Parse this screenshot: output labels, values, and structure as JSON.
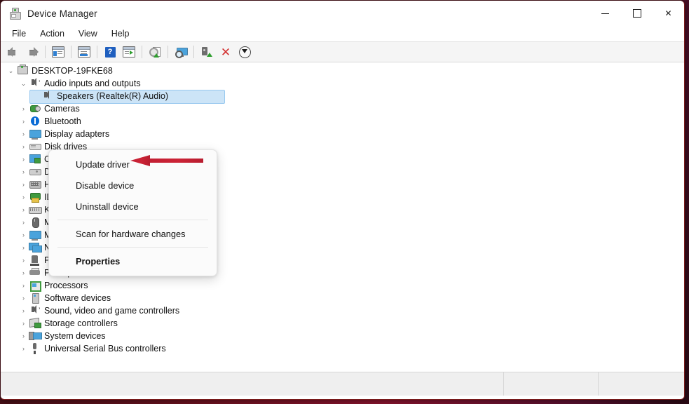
{
  "window": {
    "title": "Device Manager",
    "icon": "device-manager-icon",
    "caption": {
      "minimize": "minimize",
      "maximize": "maximize",
      "close": "close"
    }
  },
  "menubar": {
    "items": [
      "File",
      "Action",
      "View",
      "Help"
    ]
  },
  "toolbar": {
    "buttons": [
      {
        "name": "back-icon",
        "type": "arrow-left"
      },
      {
        "name": "forward-icon",
        "type": "arrow-right"
      },
      {
        "name": "separator-1",
        "type": "sep"
      },
      {
        "name": "show-hide-console-tree-icon",
        "type": "panel-left"
      },
      {
        "name": "separator-2",
        "type": "sep"
      },
      {
        "name": "properties-icon",
        "type": "panel-props"
      },
      {
        "name": "separator-3",
        "type": "sep"
      },
      {
        "name": "help-icon",
        "type": "help"
      },
      {
        "name": "show-action-pane-icon",
        "type": "panel-play"
      },
      {
        "name": "separator-4",
        "type": "sep"
      },
      {
        "name": "update-driver-icon",
        "type": "gear-page"
      },
      {
        "name": "separator-5",
        "type": "sep"
      },
      {
        "name": "scan-for-hardware-changes-icon",
        "type": "monitor-scan"
      },
      {
        "name": "separator-6",
        "type": "sep"
      },
      {
        "name": "enable-device-icon",
        "type": "device-green"
      },
      {
        "name": "uninstall-device-icon",
        "type": "red-x"
      },
      {
        "name": "disable-device-icon",
        "type": "down-circle"
      }
    ]
  },
  "tree": {
    "nodes": [
      {
        "label": "DESKTOP-19FKE68",
        "level": 1,
        "expanded": true,
        "chevron": "⌄",
        "icon": "computer-icon",
        "selected": false
      },
      {
        "label": "Audio inputs and outputs",
        "level": 2,
        "expanded": true,
        "chevron": "⌄",
        "icon": "speaker-icon",
        "selected": false
      },
      {
        "label": "Speakers (Realtek(R) Audio)",
        "level": 3,
        "expanded": false,
        "chevron": "",
        "icon": "audio-device-icon",
        "selected": true
      },
      {
        "label": "Cameras",
        "level": 2,
        "expanded": false,
        "chevron": "›",
        "icon": "camera-icon",
        "selected": false
      },
      {
        "label": "Bluetooth",
        "level": 2,
        "expanded": false,
        "chevron": "›",
        "icon": "bluetooth-icon",
        "selected": false
      },
      {
        "label": "Display adapters",
        "level": 2,
        "expanded": false,
        "chevron": "›",
        "icon": "display-adapter-icon",
        "selected": false
      },
      {
        "label": "Disk drives",
        "level": 2,
        "expanded": false,
        "chevron": "›",
        "icon": "disk-drive-icon",
        "selected": false
      },
      {
        "label": "Computer",
        "level": 2,
        "expanded": false,
        "chevron": "›",
        "icon": "computer-node-icon",
        "selected": false
      },
      {
        "label": "DVD/CD-ROM drives",
        "level": 2,
        "expanded": false,
        "chevron": "›",
        "icon": "dvd-drive-icon",
        "selected": false
      },
      {
        "label": "Human Interface Devices",
        "level": 2,
        "expanded": false,
        "chevron": "›",
        "icon": "hid-icon",
        "selected": false
      },
      {
        "label": "IDE ATA/ATAPI controllers",
        "level": 2,
        "expanded": false,
        "chevron": "›",
        "icon": "ide-controller-icon",
        "selected": false
      },
      {
        "label": "Keyboards",
        "level": 2,
        "expanded": false,
        "chevron": "›",
        "icon": "keyboard-icon",
        "selected": false
      },
      {
        "label": "Mice and other pointing devices",
        "level": 2,
        "expanded": false,
        "chevron": "›",
        "icon": "mouse-icon",
        "selected": false
      },
      {
        "label": "Monitors",
        "level": 2,
        "expanded": false,
        "chevron": "›",
        "icon": "monitor-icon",
        "selected": false
      },
      {
        "label": "Network adapters",
        "level": 2,
        "expanded": false,
        "chevron": "›",
        "icon": "network-adapter-icon",
        "selected": false
      },
      {
        "label": "Ports (COM & LPT)",
        "level": 2,
        "expanded": false,
        "chevron": "›",
        "icon": "port-icon",
        "selected": false
      },
      {
        "label": "Print queues",
        "level": 2,
        "expanded": false,
        "chevron": "›",
        "icon": "printer-icon",
        "selected": false
      },
      {
        "label": "Processors",
        "level": 2,
        "expanded": false,
        "chevron": "›",
        "icon": "processor-icon",
        "selected": false
      },
      {
        "label": "Software devices",
        "level": 2,
        "expanded": false,
        "chevron": "›",
        "icon": "software-device-icon",
        "selected": false
      },
      {
        "label": "Sound, video and game controllers",
        "level": 2,
        "expanded": false,
        "chevron": "›",
        "icon": "sound-controller-icon",
        "selected": false
      },
      {
        "label": "Storage controllers",
        "level": 2,
        "expanded": false,
        "chevron": "›",
        "icon": "storage-controller-icon",
        "selected": false
      },
      {
        "label": "System devices",
        "level": 2,
        "expanded": false,
        "chevron": "›",
        "icon": "system-device-icon",
        "selected": false
      },
      {
        "label": "Universal Serial Bus controllers",
        "level": 2,
        "expanded": false,
        "chevron": "›",
        "icon": "usb-controller-icon",
        "selected": false
      }
    ]
  },
  "context_menu": {
    "items": [
      {
        "label": "Update driver",
        "bold": false
      },
      {
        "label": "Disable device",
        "bold": false
      },
      {
        "label": "Uninstall device",
        "bold": false
      },
      {
        "label": "Scan for hardware changes",
        "bold": false
      },
      {
        "label": "Properties",
        "bold": true
      }
    ]
  },
  "annotation": {
    "arrow": "red-left-arrow",
    "points_to": "Update driver",
    "color": "#cc2336"
  },
  "statusbar": {
    "panes": [
      "",
      "",
      ""
    ]
  },
  "colors": {
    "selection_fill": "#cce4f7",
    "selection_border": "#99c9ef",
    "accent_red": "#cc2336",
    "window_border": "#7a1a1a",
    "toolbar_bg": "#f5f5f5",
    "statusbar_bg": "#efefef"
  }
}
